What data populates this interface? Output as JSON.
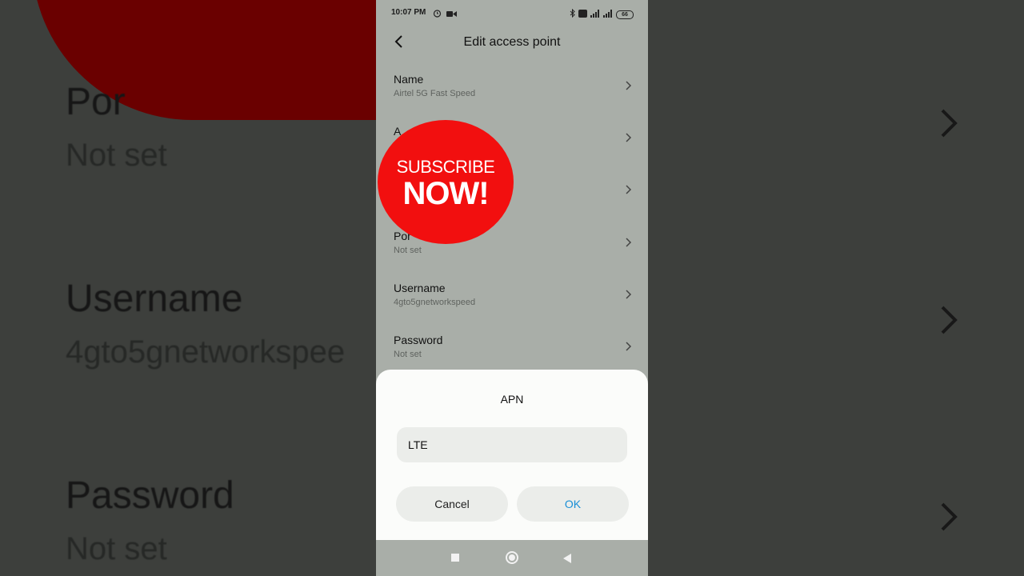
{
  "status_bar": {
    "time": "10:07 PM",
    "battery": "66"
  },
  "app_bar": {
    "title": "Edit access point"
  },
  "rows": [
    {
      "label": "Name",
      "value": "Airtel 5G Fast Speed"
    },
    {
      "label": "A",
      "value": ""
    },
    {
      "label": "",
      "value": ""
    },
    {
      "label": "Por",
      "value": "Not set"
    },
    {
      "label": "Username",
      "value": "4gto5gnetworkspeed"
    },
    {
      "label": "Password",
      "value": "Not set"
    }
  ],
  "subscribe_badge": {
    "line1": "SUBSCRIBE",
    "line2": "NOW!"
  },
  "dialog": {
    "title": "APN",
    "input_value": "LTE",
    "cancel_label": "Cancel",
    "ok_label": "OK",
    "ok_color": "#1a8fd6"
  },
  "background": {
    "item1_label": "Por",
    "item1_value": "Not set",
    "item2_label": "Username",
    "item2_value": "4gto5gnetworkspee",
    "item3_label": "Password",
    "item3_value": "Not set"
  },
  "icons": {
    "back": "chevron-left-icon",
    "row_chevron": "chevron-right-icon",
    "alarm": "alarm-icon",
    "video": "video-camera-icon",
    "bluetooth": "bluetooth-icon",
    "signal": "signal-icon"
  }
}
